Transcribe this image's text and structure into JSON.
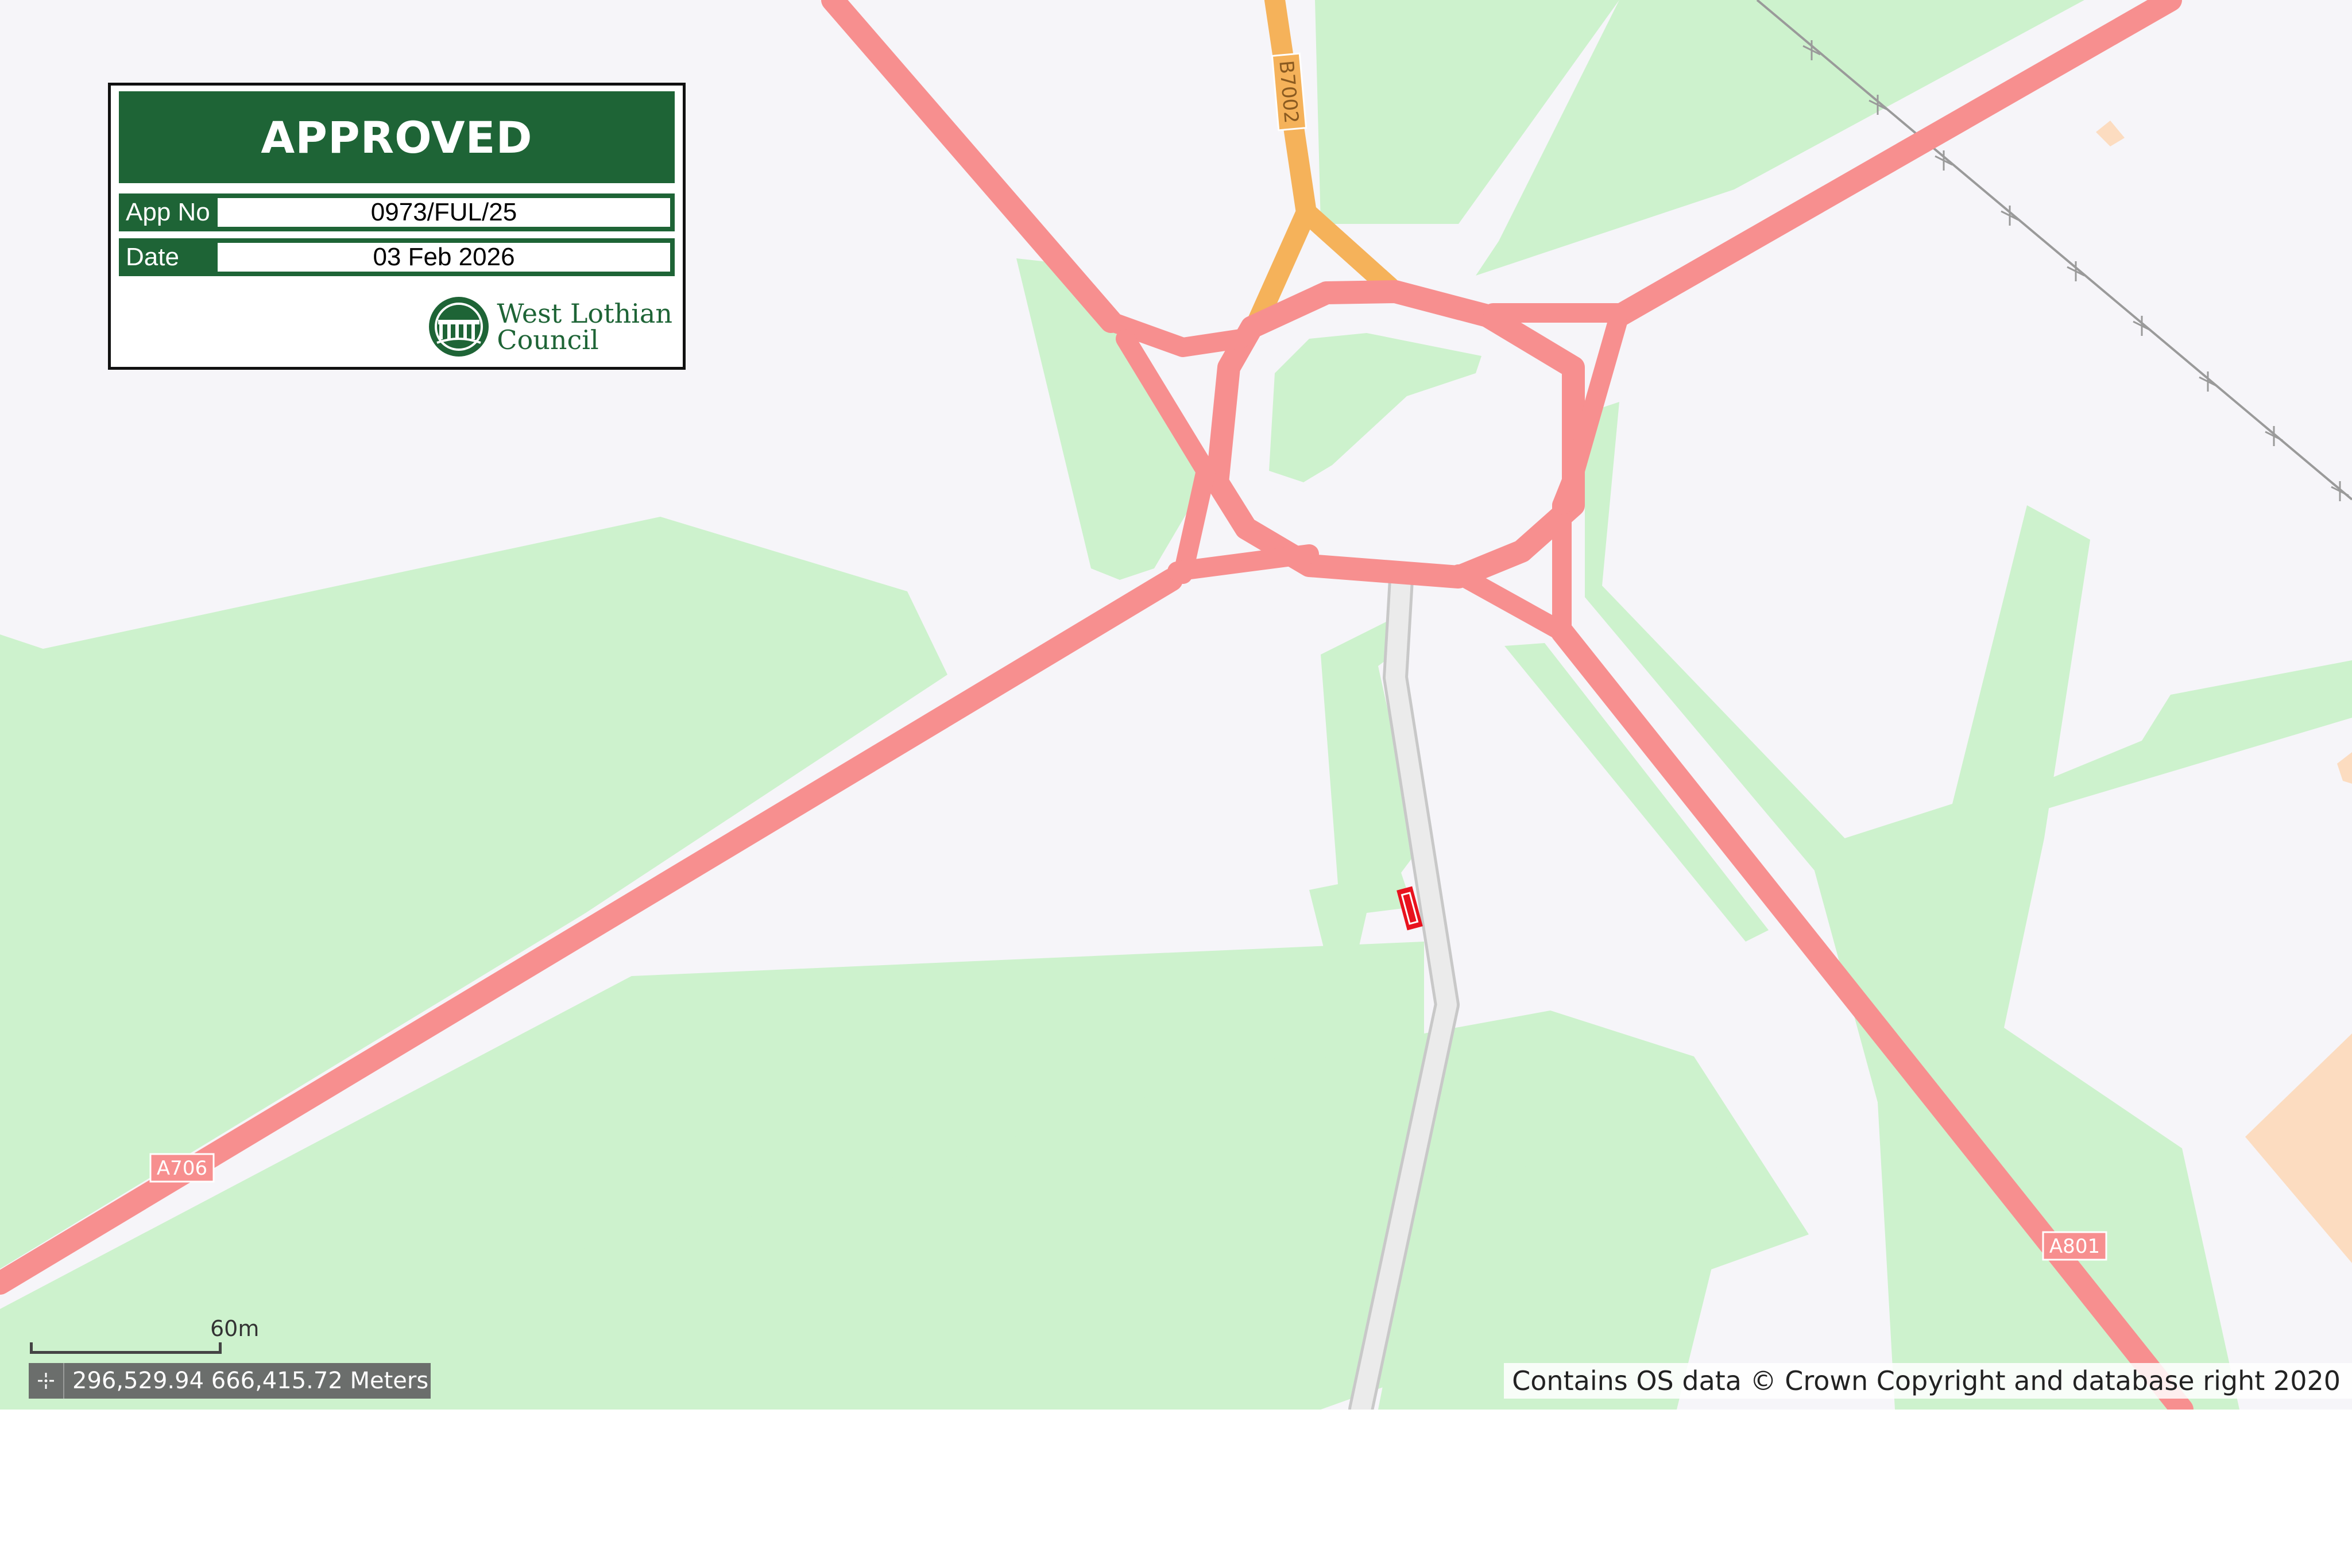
{
  "stamp": {
    "title": "APPROVED",
    "app_no_label": "App No",
    "app_no_value": "0973/FUL/25",
    "date_label": "Date",
    "date_value": "03 Feb 2026",
    "council_line1": "West Lothian",
    "council_line2": "Council"
  },
  "map": {
    "roads": [
      {
        "label": "A706",
        "class": "primary"
      },
      {
        "label": "A801",
        "class": "primary"
      },
      {
        "label": "B7002",
        "class": "secondary"
      }
    ],
    "scale_label": "60m",
    "coordinates": "296,529.94 666,415.72 Meters",
    "attribution": "Contains OS data © Crown Copyright and database right 2020"
  },
  "colors": {
    "background": "#f6f5f9",
    "woodland": "#cdf2cd",
    "primary_road": "#f78f8f",
    "secondary_road": "#f5b25a",
    "track": "#e6e6e6",
    "industrial": "#fcdcc0",
    "site_marker": "#e8121e",
    "stamp_green": "#1e6436"
  },
  "icons": [
    "crosshair-icon",
    "council-viaduct-logo-icon"
  ]
}
